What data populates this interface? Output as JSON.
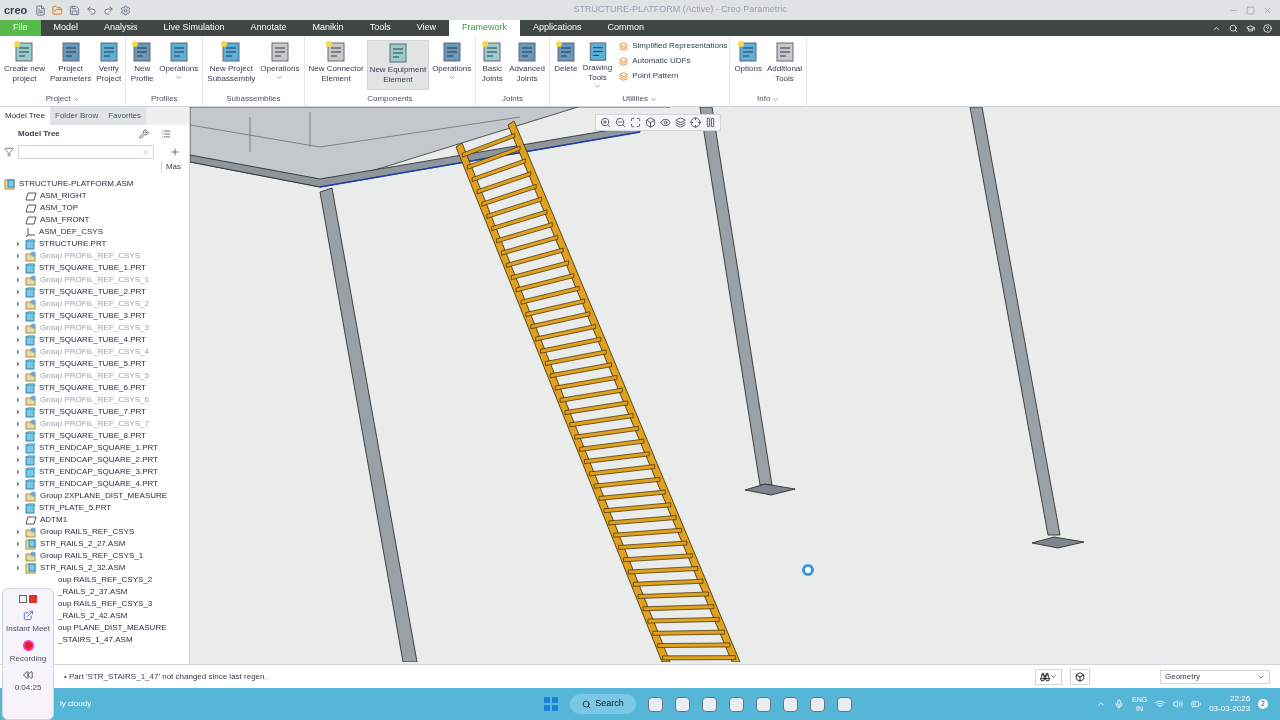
{
  "window": {
    "logo": "creo",
    "title": "STRUCTURE-PLATFORM (Active) - Creo Parametric"
  },
  "tabs": [
    {
      "label": "File",
      "kind": "file",
      "selected": false
    },
    {
      "label": "Model",
      "kind": "tab",
      "selected": false
    },
    {
      "label": "Analysis",
      "kind": "tab",
      "selected": false
    },
    {
      "label": "Live Simulation",
      "kind": "tab",
      "selected": false
    },
    {
      "label": "Annotate",
      "kind": "tab",
      "selected": false
    },
    {
      "label": "Manikin",
      "kind": "tab",
      "selected": false
    },
    {
      "label": "Tools",
      "kind": "tab",
      "selected": false
    },
    {
      "label": "View",
      "kind": "tab",
      "selected": false
    },
    {
      "label": "Framework",
      "kind": "tab",
      "selected": true
    },
    {
      "label": "Applications",
      "kind": "tab",
      "selected": false
    },
    {
      "label": "Common",
      "kind": "tab",
      "selected": false
    }
  ],
  "ribbon": [
    {
      "label": "Project",
      "menu": true,
      "buttons": [
        {
          "label": "Create new\nproject",
          "menu": false,
          "selected": false
        },
        {
          "label": "Project\nParameters",
          "menu": false,
          "selected": false
        },
        {
          "label": "Verify\nProject",
          "menu": false,
          "selected": false
        }
      ]
    },
    {
      "label": "Profiles",
      "menu": false,
      "buttons": [
        {
          "label": "New\nProfile",
          "menu": false,
          "selected": false
        },
        {
          "label": "Operations",
          "menu": true,
          "selected": false
        }
      ]
    },
    {
      "label": "Subassemblies",
      "menu": false,
      "buttons": [
        {
          "label": "New Project\nSubassembly",
          "menu": false,
          "selected": false
        },
        {
          "label": "Operations",
          "menu": true,
          "selected": false
        }
      ]
    },
    {
      "label": "Components",
      "menu": false,
      "buttons": [
        {
          "label": "New Connector\nElement",
          "menu": false,
          "selected": false
        },
        {
          "label": "New Equipment\nElement",
          "menu": false,
          "selected": true
        },
        {
          "label": "Operations",
          "menu": true,
          "selected": false
        }
      ]
    },
    {
      "label": "Joints",
      "menu": false,
      "buttons": [
        {
          "label": "Basic\nJoints",
          "menu": false,
          "selected": false
        },
        {
          "label": "Advanced\nJoints",
          "menu": false,
          "selected": false
        }
      ]
    },
    {
      "label": "Utilities",
      "menu": true,
      "buttons": [
        {
          "label": "Delete",
          "menu": false,
          "selected": false
        },
        {
          "label": "Drawing\nTools",
          "menu": true,
          "selected": false
        }
      ],
      "small_items": [
        "Simplified Representations",
        "Automatic UDFs",
        "Point Pattern"
      ]
    },
    {
      "label": "Info",
      "menu": true,
      "buttons": [
        {
          "label": "Options",
          "menu": false,
          "selected": false
        },
        {
          "label": "Additional\nTools",
          "menu": false,
          "selected": false
        }
      ]
    }
  ],
  "panel_tabs": [
    {
      "label": "Model Tree",
      "selected": true
    },
    {
      "label": "Folder Brow",
      "selected": false
    },
    {
      "label": "Favorites",
      "selected": false
    }
  ],
  "tree_header": "Model Tree",
  "column_header": "Mas",
  "tree": [
    {
      "label": "STRUCTURE-PLATFORM.ASM",
      "kind": "assembly",
      "disabled": false,
      "children": [
        {
          "label": "ASM_RIGHT",
          "kind": "plane",
          "disabled": false
        },
        {
          "label": "ASM_TOP",
          "kind": "plane",
          "disabled": false
        },
        {
          "label": "ASM_FRONT",
          "kind": "plane",
          "disabled": false
        },
        {
          "label": "ASM_DEF_CSYS",
          "kind": "csys",
          "disabled": false
        },
        {
          "label": "STRUCTURE.PRT",
          "kind": "part",
          "disabled": false
        },
        {
          "label": "Group PROFIL_REF_CSYS",
          "kind": "group",
          "disabled": true
        },
        {
          "label": "STR_SQUARE_TUBE_1.PRT",
          "kind": "part",
          "disabled": false
        },
        {
          "label": "Group PROFIL_REF_CSYS_1",
          "kind": "group",
          "disabled": true
        },
        {
          "label": "STR_SQUARE_TUBE_2.PRT",
          "kind": "part",
          "disabled": false
        },
        {
          "label": "Group PROFIL_REF_CSYS_2",
          "kind": "group",
          "disabled": true
        },
        {
          "label": "STR_SQUARE_TUBE_3.PRT",
          "kind": "part",
          "disabled": false
        },
        {
          "label": "Group PROFIL_REF_CSYS_3",
          "kind": "group",
          "disabled": true
        },
        {
          "label": "STR_SQUARE_TUBE_4.PRT",
          "kind": "part",
          "disabled": false
        },
        {
          "label": "Group PROFIL_REF_CSYS_4",
          "kind": "group",
          "disabled": true
        },
        {
          "label": "STR_SQUARE_TUBE_5.PRT",
          "kind": "part",
          "disabled": false
        },
        {
          "label": "Group PROFIL_REF_CSYS_5",
          "kind": "group",
          "disabled": true
        },
        {
          "label": "STR_SQUARE_TUBE_6.PRT",
          "kind": "part",
          "disabled": false
        },
        {
          "label": "Group PROFIL_REF_CSYS_6",
          "kind": "group",
          "disabled": true
        },
        {
          "label": "STR_SQUARE_TUBE_7.PRT",
          "kind": "part",
          "disabled": false
        },
        {
          "label": "Group PROFIL_REF_CSYS_7",
          "kind": "group",
          "disabled": true
        },
        {
          "label": "STR_SQUARE_TUBE_8.PRT",
          "kind": "part",
          "disabled": false
        },
        {
          "label": "STR_ENDCAP_SQUARE_1.PRT",
          "kind": "part",
          "disabled": false
        },
        {
          "label": "STR_ENDCAP_SQUARE_2.PRT",
          "kind": "part",
          "disabled": false
        },
        {
          "label": "STR_ENDCAP_SQUARE_3.PRT",
          "kind": "part",
          "disabled": false
        },
        {
          "label": "STR_ENDCAP_SQUARE_4.PRT",
          "kind": "part",
          "disabled": false
        },
        {
          "label": "Group 2XPLANE_DIST_MEASURE",
          "kind": "group",
          "disabled": false
        },
        {
          "label": "STR_PLATE_5.PRT",
          "kind": "part",
          "disabled": false
        },
        {
          "label": "ADTM1",
          "kind": "plane",
          "disabled": false
        },
        {
          "label": "Group RAILS_REF_CSYS",
          "kind": "group",
          "disabled": false
        },
        {
          "label": "STR_RAILS_2_27.ASM",
          "kind": "assembly",
          "disabled": false
        },
        {
          "label": "Group RAILS_REF_CSYS_1",
          "kind": "group",
          "disabled": false
        },
        {
          "label": "STR_RAILS_2_32.ASM",
          "kind": "assembly",
          "disabled": false
        },
        {
          "label": "oup RAILS_REF_CSYS_2",
          "kind": "hidden",
          "disabled": false
        },
        {
          "label": "_RAILS_2_37.ASM",
          "kind": "hidden",
          "disabled": false
        },
        {
          "label": "oup RAILS_REF_CSYS_3",
          "kind": "hidden",
          "disabled": false
        },
        {
          "label": "_RAILS_2_42.ASM",
          "kind": "hidden",
          "disabled": false
        },
        {
          "label": "oup PLANE_DIST_MEASURE",
          "kind": "hidden",
          "disabled": false
        },
        {
          "label": "_STAIRS_1_47.ASM",
          "kind": "hidden",
          "disabled": false
        }
      ]
    }
  ],
  "status_bar": {
    "message": "• Part 'STR_STAIRS_1_47' not changed since last regen.",
    "filter": "Geometry"
  },
  "recorder": {
    "meet": "Instant Meet",
    "recording": "Recording",
    "time": "0:04:25"
  },
  "taskbar": {
    "weather": "ly cloudy",
    "search": "Search",
    "language": "ENG",
    "region": "IN",
    "time": "22:26",
    "date": "03-03-2023",
    "notifications": "2"
  }
}
